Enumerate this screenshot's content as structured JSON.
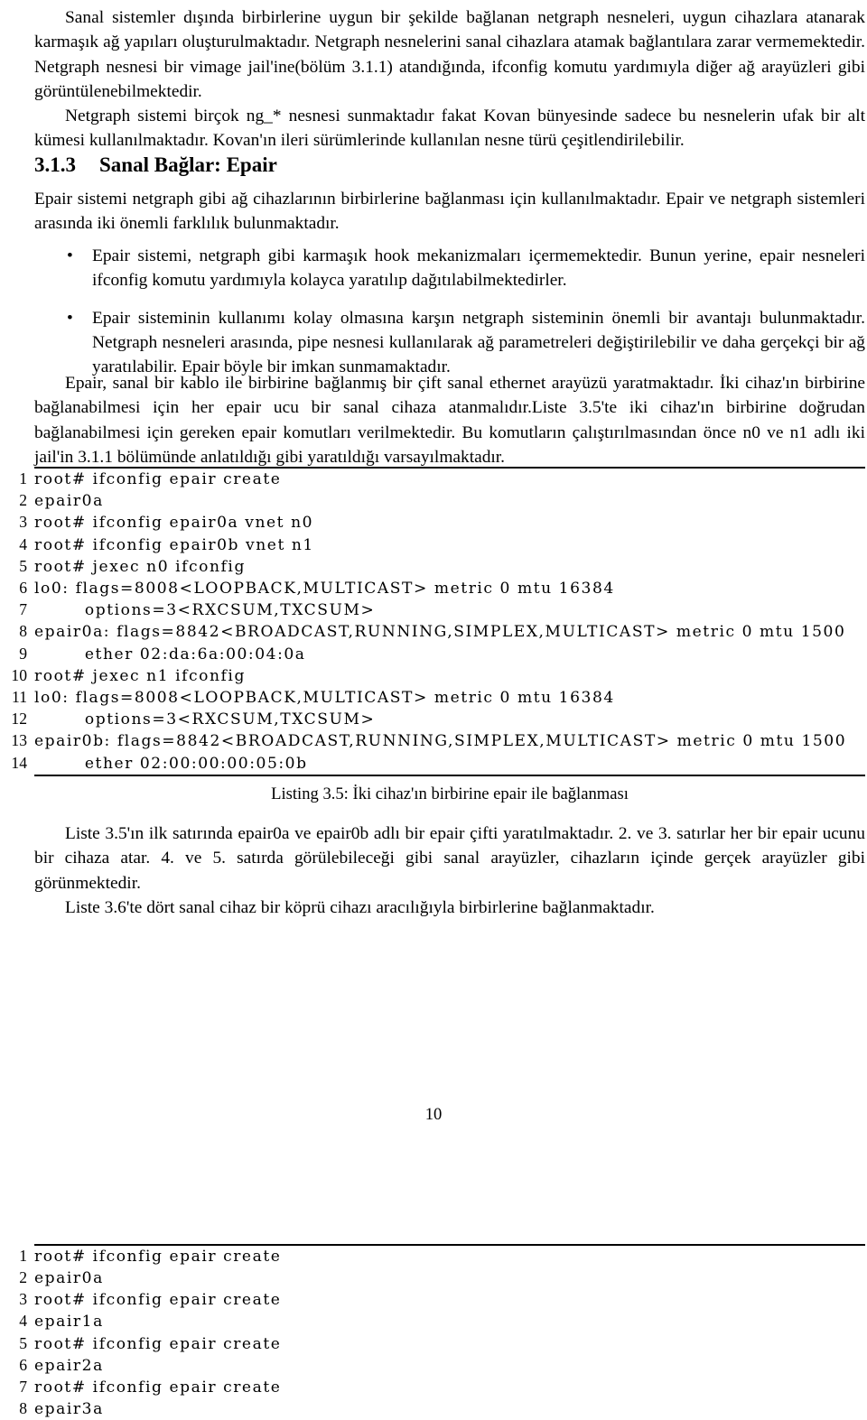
{
  "page": {
    "number": "10",
    "language": "tr"
  },
  "intro": {
    "paragraph_1": "Sanal sistemler dışında birbirlerine uygun bir şekilde bağlanan netgraph nesneleri, uygun cihazlara atanarak karmaşık ağ yapıları oluşturulmaktadır. Netgraph nesnelerini sanal cihazlara atamak bağlantılara zarar vermemektedir. Netgraph nesnesi bir vimage jail'ine(bölüm 3.1.1) atandığında, ifconfig komutu yardımıyla diğer ağ arayüzleri gibi görüntülenebilmektedir.",
    "paragraph_2": "Netgraph sistemi birçok ng_* nesnesi sunmaktadır fakat Kovan bünyesinde sadece bu nesnelerin ufak bir alt kümesi kullanılmaktadır. Kovan'ın ileri sürümlerinde kullanılan nesne türü çeşitlendirilebilir."
  },
  "section": {
    "number": "3.1.3",
    "title": "Sanal Bağlar: Epair",
    "paragraph_1": "Epair sistemi netgraph gibi ağ cihazlarının birbirlerine bağlanması için kullanılmaktadır. Epair ve netgraph sistemleri arasında iki önemli farklılık bulunmaktadır.",
    "bullets": [
      "Epair sistemi, netgraph gibi karmaşık hook mekanizmaları içermemektedir. Bunun yerine, epair nesneleri ifconfig komutu yardımıyla kolayca yaratılıp dağıtılabilmektedirler.",
      "Epair sisteminin kullanımı kolay olmasına karşın netgraph sisteminin önemli bir avantajı bulunmaktadır. Netgraph nesneleri arasında, pipe nesnesi kullanılarak ağ parametreleri değiştirilebilir ve daha gerçekçi bir ağ yaratılabilir. Epair böyle bir imkan sunmamaktadır."
    ],
    "paragraph_2": "Epair, sanal bir kablo ile birbirine bağlanmış bir çift sanal ethernet arayüzü yaratmaktadır. İki cihaz'ın birbirine bağlanabilmesi için her epair ucu bir sanal cihaza atanmalıdır.Liste 3.5'te iki cihaz'ın birbirine doğrudan bağlanabilmesi için gereken epair komutları verilmektedir. Bu komutların çalıştırılmasından önce n0 ve n1 adlı iki jail'in 3.1.1 bölümünde anlatıldığı gibi yaratıldığı varsayılmaktadır."
  },
  "listing_35": {
    "caption": "Listing 3.5: İki cihaz'ın birbirine epair ile bağlanması",
    "lines": [
      {
        "n": "1",
        "code": "root# ifconfig epair create"
      },
      {
        "n": "2",
        "code": "epair0a"
      },
      {
        "n": "3",
        "code": "root# ifconfig epair0a vnet n0"
      },
      {
        "n": "4",
        "code": "root# ifconfig epair0b vnet n1"
      },
      {
        "n": "5",
        "code": "root# jexec n0 ifconfig"
      },
      {
        "n": "6",
        "code": "lo0: flags=8008<LOOPBACK,MULTICAST> metric 0 mtu 16384"
      },
      {
        "n": "7",
        "code": "        options=3<RXCSUM,TXCSUM>"
      },
      {
        "n": "8",
        "code": "epair0a: flags=8842<BROADCAST,RUNNING,SIMPLEX,MULTICAST> metric 0 mtu 1500"
      },
      {
        "n": "9",
        "code": "        ether 02:da:6a:00:04:0a"
      },
      {
        "n": "10",
        "code": "root# jexec n1 ifconfig"
      },
      {
        "n": "11",
        "code": "lo0: flags=8008<LOOPBACK,MULTICAST> metric 0 mtu 16384"
      },
      {
        "n": "12",
        "code": "        options=3<RXCSUM,TXCSUM>"
      },
      {
        "n": "13",
        "code": "epair0b: flags=8842<BROADCAST,RUNNING,SIMPLEX,MULTICAST> metric 0 mtu 1500"
      },
      {
        "n": "14",
        "code": "        ether 02:00:00:00:05:0b"
      }
    ]
  },
  "after_listing": {
    "paragraph_1": "Liste 3.5'ın ilk satırında epair0a ve epair0b adlı bir epair çifti yaratılmaktadır. 2. ve 3. satırlar her bir epair ucunu bir cihaza atar. 4. ve 5. satırda görülebileceği gibi sanal arayüzler, cihazların içinde gerçek arayüzler gibi görünmektedir.",
    "paragraph_2": "Liste 3.6'te dört sanal cihaz bir köprü cihazı aracılığıyla birbirlerine bağlanmaktadır."
  },
  "listing_36": {
    "lines": [
      {
        "n": "1",
        "code": "root# ifconfig epair create"
      },
      {
        "n": "2",
        "code": "epair0a"
      },
      {
        "n": "3",
        "code": "root# ifconfig epair create"
      },
      {
        "n": "4",
        "code": "epair1a"
      },
      {
        "n": "5",
        "code": "root# ifconfig epair create"
      },
      {
        "n": "6",
        "code": "epair2a"
      },
      {
        "n": "7",
        "code": "root# ifconfig epair create"
      },
      {
        "n": "8",
        "code": "epair3a"
      }
    ]
  }
}
